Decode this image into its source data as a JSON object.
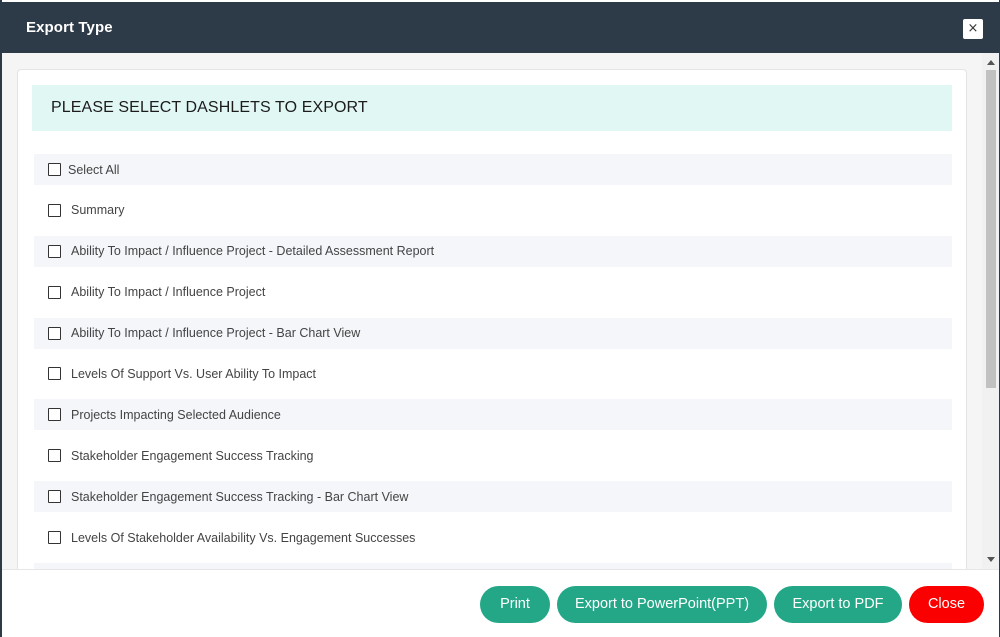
{
  "modal": {
    "title": "Export Type",
    "close_icon": "×"
  },
  "banner": {
    "text": "PLEASE SELECT DASHLETS TO EXPORT"
  },
  "dashlets": {
    "items": [
      {
        "label": "Select All",
        "checked": false
      },
      {
        "label": "Summary",
        "checked": false
      },
      {
        "label": "Ability To Impact / Influence Project - Detailed Assessment Report",
        "checked": false
      },
      {
        "label": "Ability To Impact / Influence Project",
        "checked": false
      },
      {
        "label": "Ability To Impact / Influence Project - Bar Chart View",
        "checked": false
      },
      {
        "label": "Levels Of Support Vs. User Ability To Impact",
        "checked": false
      },
      {
        "label": "Projects Impacting Selected Audience",
        "checked": false
      },
      {
        "label": "Stakeholder Engagement Success Tracking",
        "checked": false
      },
      {
        "label": "Stakeholder Engagement Success Tracking - Bar Chart View",
        "checked": false
      },
      {
        "label": "Levels Of Stakeholder Availability Vs. Engagement Successes",
        "checked": false
      },
      {
        "label": "",
        "checked": false
      }
    ]
  },
  "footer": {
    "print_label": "Print",
    "ppt_label": "Export to PowerPoint(PPT)",
    "pdf_label": "Export to PDF",
    "close_label": "Close"
  },
  "colors": {
    "header_bg": "#2d3b48",
    "banner_bg": "#e0f7f3",
    "primary_button": "#23a786",
    "danger_button": "#fb0000",
    "row_shade": "#f4f6f9"
  },
  "icons": {
    "close": "close-icon",
    "scroll_up": "arrow-up-icon",
    "scroll_down": "arrow-down-icon"
  }
}
